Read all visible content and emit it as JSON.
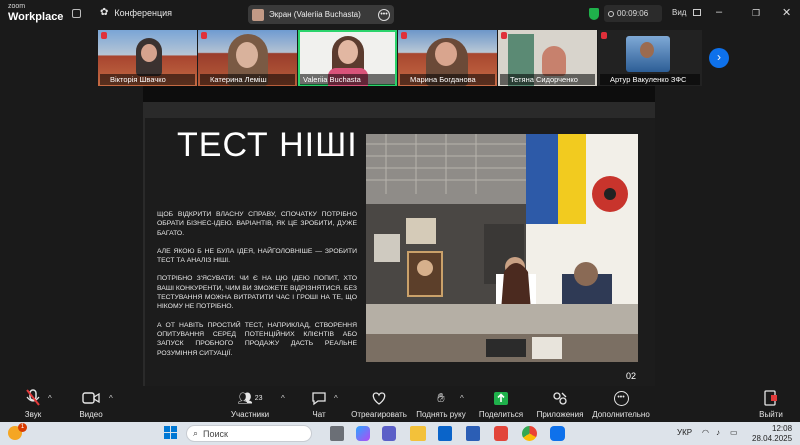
{
  "app": {
    "logo_top": "zoom",
    "logo_bottom": "Workplace",
    "meeting_label": "Конференция",
    "screen_share_label": "Экран (Valeriia Buchasta)",
    "timer": "00:09:06",
    "view_label": "Вид",
    "accent_green": "#1fb14b"
  },
  "gallery": {
    "participants": [
      {
        "name": "Вікторія Швачко",
        "muted": true
      },
      {
        "name": "Катерина Леміш",
        "muted": true
      },
      {
        "name": "Valeriia Buchasta",
        "muted": false,
        "active": true
      },
      {
        "name": "Марина Богданова",
        "muted": true
      },
      {
        "name": "Тетяна Сидорченко",
        "muted": true
      },
      {
        "name": "Артур Вакуленко ЗФС",
        "muted": true
      }
    ]
  },
  "slide": {
    "title": "ТЕСТ НІШІ",
    "paragraphs": [
      "ЩОБ ВІДКРИТИ ВЛАСНУ СПРАВУ, СПОЧАТКУ ПОТРІБНО ОБРАТИ БІЗНЕС-ІДЕЮ. ВАРІАНТІВ, ЯК ЦЕ ЗРОБИТИ, ДУЖЕ БАГАТО.",
      "АЛЕ ЯКОЮ Б НЕ БУЛА ІДЕЯ, НАЙГОЛОВНІШЕ — ЗРОБИТИ ТЕСТ ТА АНАЛІЗ НІШІ.",
      "ПОТРІБНО З'ЯСУВАТИ: ЧИ Є НА ЦЮ ІДЕЮ ПОПИТ, ХТО ВАШІ КОНКУРЕНТИ, ЧИМ ВИ ЗМОЖЕТЕ ВІДРІЗНЯТИСЯ. БЕЗ ТЕСТУВАННЯ МОЖНА ВИТРАТИТИ ЧАС І ГРОШІ НА ТЕ, ЩО НІКОМУ НЕ ПОТРІБНО.",
      "А ОТ НАВІТЬ ПРОСТИЙ ТЕСТ, НАПРИКЛАД, СТВОРЕННЯ ОПИТУВАННЯ СЕРЕД ПОТЕНЦІЙНИХ КЛІЄНТІВ АБО ЗАПУСК ПРОБНОГО ПРОДАЖУ ДАСТЬ РЕАЛЬНЕ РОЗУМІННЯ СИТУАЦІЇ."
    ],
    "page_number": "02"
  },
  "toolbar": {
    "audio": "Звук",
    "video": "Видео",
    "participants": "Участники",
    "participants_count": "23",
    "chat": "Чат",
    "react": "Отреагировать",
    "raise_hand": "Поднять руку",
    "share": "Поделиться",
    "apps": "Приложения",
    "more": "Дополнительно",
    "leave": "Выйти"
  },
  "taskbar": {
    "search_placeholder": "Поиск",
    "language": "УКР",
    "time": "12:08",
    "date": "28.04.2025",
    "notification_count": "1"
  }
}
